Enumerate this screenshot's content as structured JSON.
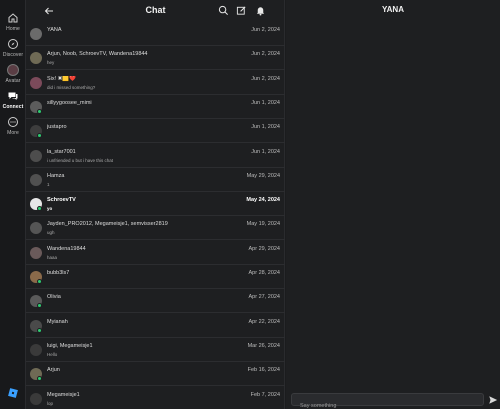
{
  "nav": {
    "items": [
      {
        "label": "Home",
        "icon": "home-icon"
      },
      {
        "label": "Discover",
        "icon": "compass-icon"
      },
      {
        "label": "Avatar",
        "icon": "avatar-icon"
      },
      {
        "label": "Connect",
        "icon": "connect-icon"
      },
      {
        "label": "More",
        "icon": "more-icon"
      }
    ],
    "active": "Connect",
    "logo_icon": "roblox-logo-icon"
  },
  "chat": {
    "title": "Chat",
    "header_icons": [
      "search-icon",
      "compose-icon",
      "notification-bell-icon"
    ],
    "conversations": [
      {
        "name": "YANA",
        "preview": "",
        "date": "Jun 2, 2024",
        "bold": false,
        "online": false,
        "avatar_color": "#6b6b6b"
      },
      {
        "name": "Arjun, Noob, SchroevTV, Wandena19844",
        "preview": "hey",
        "date": "Jun 2, 2024",
        "bold": false,
        "online": false,
        "avatar_color": "#6f6a55"
      },
      {
        "name": "Six! ✖🟨❤️",
        "preview": "did i missed something?",
        "date": "Jun 2, 2024",
        "bold": false,
        "online": false,
        "avatar_color": "#7b4a5a"
      },
      {
        "name": "sillyygoosee_mimi",
        "preview": "",
        "date": "Jun 1, 2024",
        "bold": false,
        "online": true,
        "avatar_color": "#5c5c5c"
      },
      {
        "name": "justapro",
        "preview": "",
        "date": "Jun 1, 2024",
        "bold": false,
        "online": true,
        "avatar_color": "#3d3d3d"
      },
      {
        "name": "la_star7001",
        "preview": "i unfriended u but i have this chat",
        "date": "Jun 1, 2024",
        "bold": false,
        "online": false,
        "avatar_color": "#4d4d4d"
      },
      {
        "name": "Hamza",
        "preview": "1",
        "date": "May 29, 2024",
        "bold": false,
        "online": false,
        "avatar_color": "#505050"
      },
      {
        "name": "SchroevTV",
        "preview": "yo",
        "date": "May 24, 2024",
        "bold": true,
        "online": true,
        "avatar_color": "#e6e6e6"
      },
      {
        "name": "Jayden_PRO2012, Megameisje1, semvisser2819",
        "preview": "ugh",
        "date": "May 19, 2024",
        "bold": false,
        "online": false,
        "avatar_color": "#555555"
      },
      {
        "name": "Wandena19844",
        "preview": "haaa",
        "date": "Apr 29, 2024",
        "bold": false,
        "online": false,
        "avatar_color": "#6a5a5a"
      },
      {
        "name": "bubb3ls7",
        "preview": "",
        "date": "Apr 28, 2024",
        "bold": false,
        "online": true,
        "avatar_color": "#8a6a4a"
      },
      {
        "name": "Olivia",
        "preview": "",
        "date": "Apr 27, 2024",
        "bold": false,
        "online": true,
        "avatar_color": "#5a5a5a"
      },
      {
        "name": "Myianah",
        "preview": "",
        "date": "Apr 22, 2024",
        "bold": false,
        "online": true,
        "avatar_color": "#4a4a4a"
      },
      {
        "name": "luigi, Megameisje1",
        "preview": "Hello",
        "date": "Mar 26, 2024",
        "bold": false,
        "online": false,
        "avatar_color": "#3a3a3a"
      },
      {
        "name": "Arjun",
        "preview": "",
        "date": "Feb 16, 2024",
        "bold": false,
        "online": true,
        "avatar_color": "#6f6a55"
      },
      {
        "name": "Megameisje1",
        "preview": "lop",
        "date": "Feb 7, 2024",
        "bold": false,
        "online": false,
        "avatar_color": "#3a3a3a"
      }
    ]
  },
  "conversation": {
    "title": "YANA",
    "input_placeholder": "Say something",
    "input_value": "",
    "send_icon": "send-icon"
  },
  "colors": {
    "background": "#1e1f21",
    "nav_background": "#18191b",
    "online": "#2ecc71",
    "divider": "#2c2d30"
  }
}
